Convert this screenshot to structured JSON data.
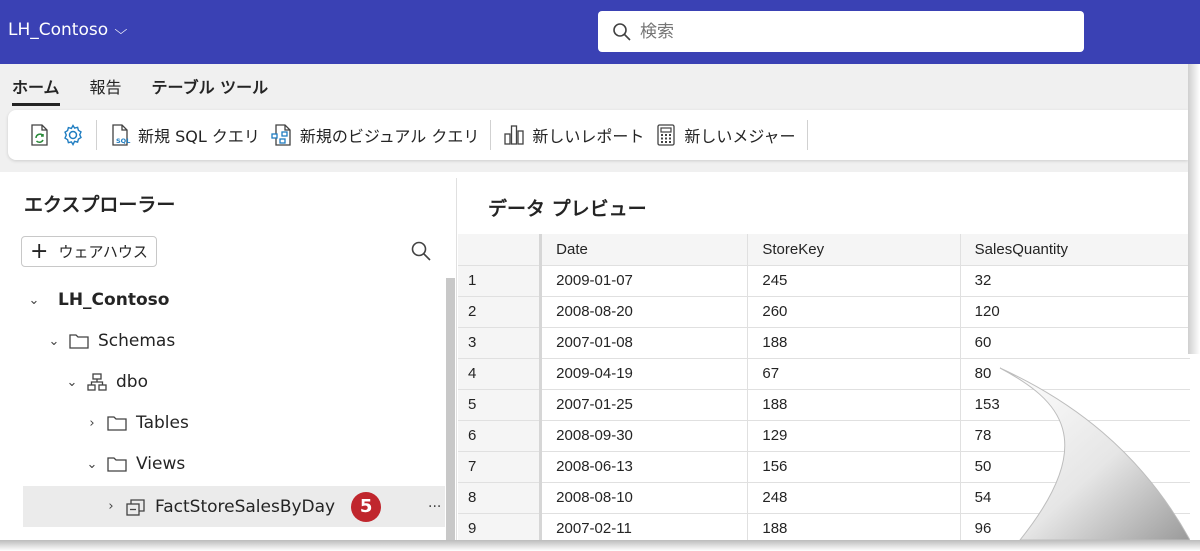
{
  "workspace": {
    "name": "LH_Contoso"
  },
  "search": {
    "placeholder": "検索"
  },
  "ribbon": {
    "tabs": [
      {
        "label": "ホーム"
      },
      {
        "label": "報告"
      },
      {
        "label": "テーブル ツール"
      }
    ],
    "toolbar": {
      "new_sql_query": "新規 SQL クエリ",
      "new_visual_query": "新規のビジュアル クエリ",
      "new_report": "新しいレポート",
      "new_measure": "新しいメジャー"
    }
  },
  "explorer": {
    "title": "エクスプローラー",
    "add_warehouse": "ウェアハウス",
    "tree": {
      "root": "LH_Contoso",
      "schemas": "Schemas",
      "dbo": "dbo",
      "tables": "Tables",
      "views": "Views",
      "view_item": "FactStoreSalesByDay",
      "badge": "5",
      "more": "···"
    }
  },
  "preview": {
    "title": "データ プレビュー",
    "columns": [
      "",
      "Date",
      "StoreKey",
      "SalesQuantity"
    ],
    "rows": [
      [
        "1",
        "2009-01-07",
        "245",
        "32"
      ],
      [
        "2",
        "2008-08-20",
        "260",
        "120"
      ],
      [
        "3",
        "2007-01-08",
        "188",
        "60"
      ],
      [
        "4",
        "2009-04-19",
        "67",
        "80"
      ],
      [
        "5",
        "2007-01-25",
        "188",
        "153"
      ],
      [
        "6",
        "2008-09-30",
        "129",
        "78"
      ],
      [
        "7",
        "2008-06-13",
        "156",
        "50"
      ],
      [
        "8",
        "2008-08-10",
        "248",
        "54"
      ],
      [
        "9",
        "2007-02-11",
        "188",
        "96"
      ]
    ]
  },
  "colors": {
    "topbar": "#3a41b4",
    "badge": "#c0262d",
    "accent_icon": "#1f7dc1",
    "refresh_icon": "#2a8a3a"
  }
}
